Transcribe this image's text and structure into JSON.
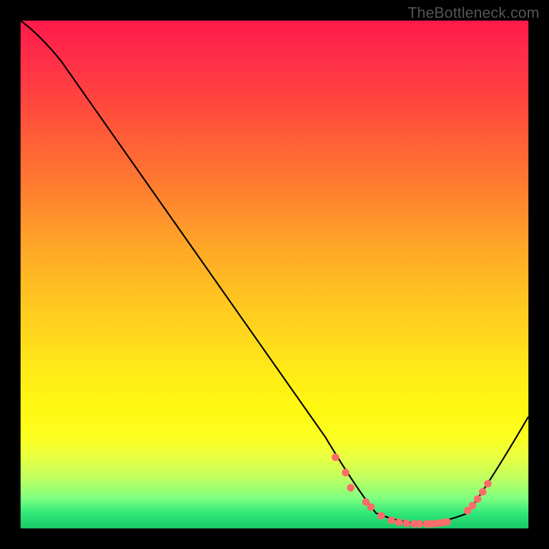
{
  "watermark": "TheBottleneck.com",
  "chart_data": {
    "type": "line",
    "title": "",
    "xlabel": "",
    "ylabel": "",
    "xlim": [
      0,
      100
    ],
    "ylim": [
      0,
      100
    ],
    "curve": [
      {
        "x": 0,
        "y": 100
      },
      {
        "x": 4,
        "y": 97
      },
      {
        "x": 8,
        "y": 92
      },
      {
        "x": 60,
        "y": 18
      },
      {
        "x": 66,
        "y": 8
      },
      {
        "x": 70,
        "y": 3
      },
      {
        "x": 75,
        "y": 1
      },
      {
        "x": 83,
        "y": 1
      },
      {
        "x": 88,
        "y": 3
      },
      {
        "x": 93,
        "y": 10
      },
      {
        "x": 100,
        "y": 22
      }
    ],
    "markers": [
      {
        "x": 62,
        "y": 14
      },
      {
        "x": 64,
        "y": 11
      },
      {
        "x": 65,
        "y": 8
      },
      {
        "x": 68,
        "y": 5.2
      },
      {
        "x": 69,
        "y": 4.2
      },
      {
        "x": 71,
        "y": 2.5
      },
      {
        "x": 73,
        "y": 1.6
      },
      {
        "x": 74.5,
        "y": 1.2
      },
      {
        "x": 76,
        "y": 1.0
      },
      {
        "x": 77.5,
        "y": 0.9
      },
      {
        "x": 78.5,
        "y": 0.9
      },
      {
        "x": 80,
        "y": 0.9
      },
      {
        "x": 81,
        "y": 0.9
      },
      {
        "x": 82,
        "y": 1.0
      },
      {
        "x": 83,
        "y": 1.1
      },
      {
        "x": 84,
        "y": 1.3
      },
      {
        "x": 88,
        "y": 3.5
      },
      {
        "x": 89,
        "y": 4.5
      },
      {
        "x": 90,
        "y": 5.8
      },
      {
        "x": 91,
        "y": 7.2
      },
      {
        "x": 92,
        "y": 8.8
      }
    ],
    "marker_color": "#ff6b6b",
    "line_color": "#000000"
  }
}
